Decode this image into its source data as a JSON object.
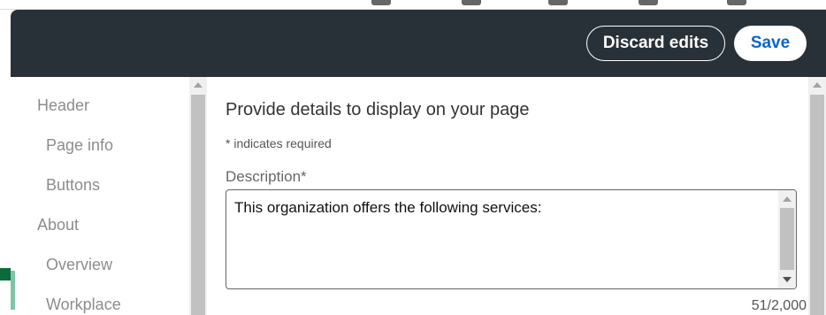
{
  "header": {
    "discard_label": "Discard edits",
    "save_label": "Save"
  },
  "side_nav": {
    "items": [
      {
        "label": "Header",
        "level": "section"
      },
      {
        "label": "Page info",
        "level": "sub"
      },
      {
        "label": "Buttons",
        "level": "sub"
      },
      {
        "label": "About",
        "level": "section"
      },
      {
        "label": "Overview",
        "level": "sub",
        "active": true
      },
      {
        "label": "Workplace",
        "level": "sub"
      }
    ]
  },
  "content": {
    "title": "Provide details to display on your page",
    "required_note": "* indicates required",
    "description": {
      "label": "Description*",
      "value": "This organization offers the following services:",
      "char_count": "51/2,000"
    }
  },
  "colors": {
    "header_bg": "#293138",
    "save_text": "#0a66c2",
    "active_indicator": "#7fc4a8"
  }
}
